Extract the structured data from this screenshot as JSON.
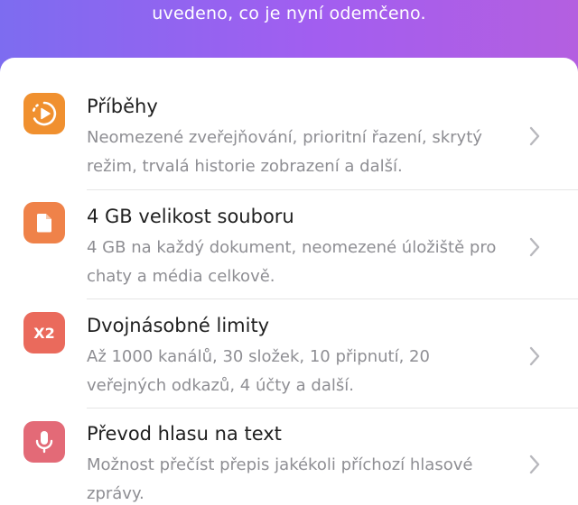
{
  "header": {
    "subtitle": "uvedeno, co je nyní odemčeno."
  },
  "features": [
    {
      "title": "Příběhy",
      "description": "Neomezené zveřejňování, prioritní řazení, skrytý režim, trvalá historie zobrazení a další.",
      "icon": "stories-icon",
      "color": "#f0902f"
    },
    {
      "title": "4 GB velikost souboru",
      "description": "4 GB na každý dokument, neomezené úložiště pro chaty a média celkově.",
      "icon": "file-icon",
      "color": "#ef8249"
    },
    {
      "title": "Dvojnásobné limity",
      "description": "Až 1000 kanálů, 30 složek, 10 připnutí, 20 veřejných odkazů, 4 účty a další.",
      "icon": "x2-icon",
      "icon_text": "X2",
      "color": "#ea6a5c"
    },
    {
      "title": "Převod hlasu na text",
      "description": "Možnost přečíst přepis jakékoli příchozí hlasové zprávy.",
      "icon": "microphone-icon",
      "color": "#e36a77"
    }
  ]
}
